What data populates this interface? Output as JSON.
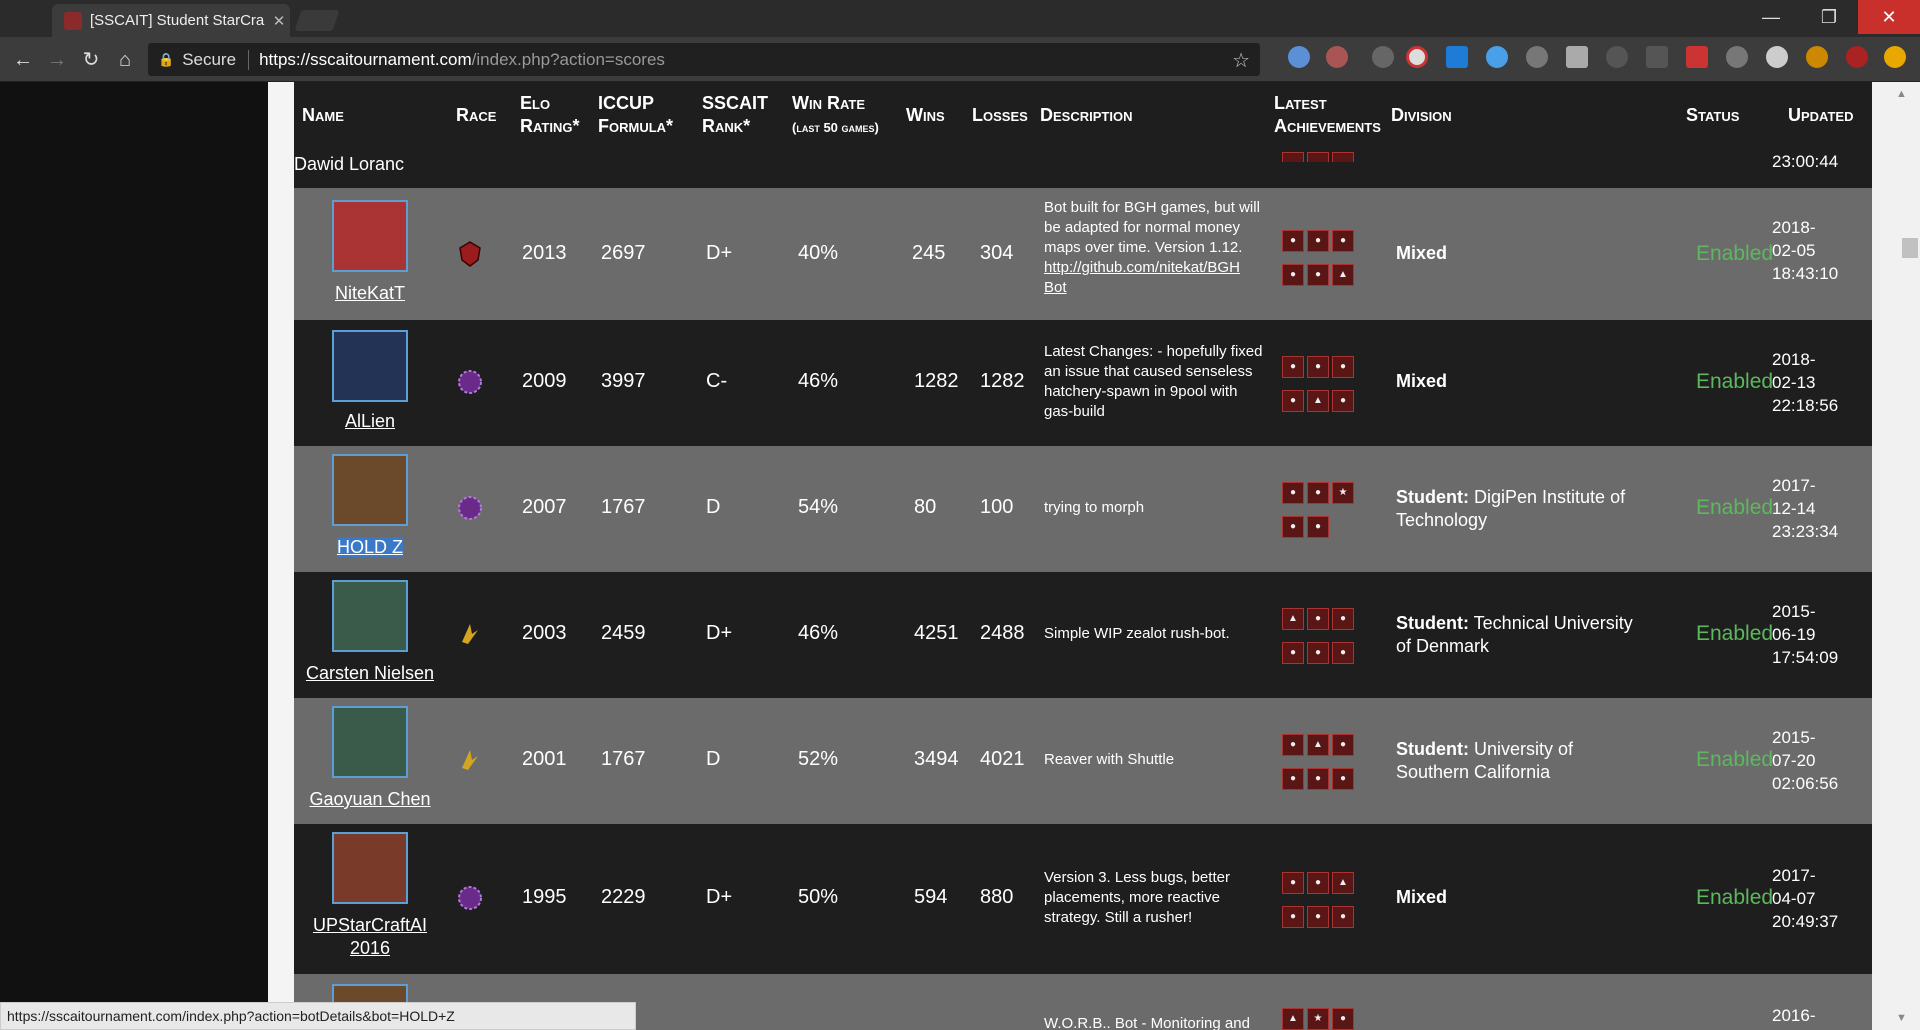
{
  "browser": {
    "tab_title": "[SSCAIT] Student StarCra",
    "url_secure": "Secure",
    "url_host": "https://sscaitournament.com",
    "url_path": "/index.php?action=scores"
  },
  "headers": {
    "name": "Name",
    "race": "Race",
    "elo1": "Elo",
    "elo2": "Rating*",
    "iccup1": "ICCUP",
    "iccup2": "Formula*",
    "rank1": "SSCAIT",
    "rank2": "Rank*",
    "winrate1": "Win Rate",
    "winrate2": "(last 50 games)",
    "wins": "Wins",
    "losses": "Losses",
    "description": "Description",
    "ach1": "Latest",
    "ach2": "Achievements",
    "division": "Division",
    "status": "Status",
    "updated": "Updated"
  },
  "partial_row": {
    "name": "Dawid Loranc",
    "updated": "23:00:44"
  },
  "rows": [
    {
      "name": "NiteKatT",
      "race": "terran",
      "elo": "2013",
      "iccup": "2697",
      "rank": "D+",
      "winrate": "40%",
      "wins": "245",
      "losses": "304",
      "desc": "Bot built for BGH games, but will be adapted for normal money maps over time. Version 1.12.",
      "desc_link": "http://github.com/nitekat/BGH Bot",
      "div_label": "Mixed",
      "div_text": "",
      "status": "Enabled",
      "upd1": "2018-",
      "upd2": "02-05",
      "upd3": "18:43:10"
    },
    {
      "name": "AlLien",
      "race": "zerg",
      "elo": "2009",
      "iccup": "3997",
      "rank": "C-",
      "winrate": "46%",
      "wins": "1282",
      "losses": "1282",
      "desc": "Latest Changes: - hopefully fixed an issue that caused senseless hatchery-spawn in 9pool with gas-build",
      "desc_link": "",
      "div_label": "Mixed",
      "div_text": "",
      "status": "Enabled",
      "upd1": "2018-",
      "upd2": "02-13",
      "upd3": "22:18:56"
    },
    {
      "name": "HOLD Z",
      "race": "zerg",
      "elo": "2007",
      "iccup": "1767",
      "rank": "D",
      "winrate": "54%",
      "wins": "80",
      "losses": "100",
      "desc": "trying to morph",
      "desc_link": "",
      "div_label": "Student:",
      "div_text": "DigiPen Institute of Technology",
      "status": "Enabled",
      "upd1": "2017-",
      "upd2": "12-14",
      "upd3": "23:23:34"
    },
    {
      "name": "Carsten Nielsen",
      "race": "protoss",
      "elo": "2003",
      "iccup": "2459",
      "rank": "D+",
      "winrate": "46%",
      "wins": "4251",
      "losses": "2488",
      "desc": "Simple WIP zealot rush-bot.",
      "desc_link": "",
      "div_label": "Student:",
      "div_text": "Technical University of Denmark",
      "status": "Enabled",
      "upd1": "2015-",
      "upd2": "06-19",
      "upd3": "17:54:09"
    },
    {
      "name": "Gaoyuan Chen",
      "race": "protoss",
      "elo": "2001",
      "iccup": "1767",
      "rank": "D",
      "winrate": "52%",
      "wins": "3494",
      "losses": "4021",
      "desc": "Reaver with Shuttle",
      "desc_link": "",
      "div_label": "Student:",
      "div_text": "University of Southern California",
      "status": "Enabled",
      "upd1": "2015-",
      "upd2": "07-20",
      "upd3": "02:06:56"
    },
    {
      "name": "UPStarCraftAI 2016",
      "race": "zerg",
      "elo": "1995",
      "iccup": "2229",
      "rank": "D+",
      "winrate": "50%",
      "wins": "594",
      "losses": "880",
      "desc": "Version 3. Less bugs, better placements, more reactive strategy. Still a rusher!",
      "desc_link": "",
      "div_label": "Mixed",
      "div_text": "",
      "status": "Enabled",
      "upd1": "2017-",
      "upd2": "04-07",
      "upd3": "20:49:37"
    }
  ],
  "bottom_row": {
    "desc": "W.O.R.B.. Bot - Monitoring and",
    "upd1": "2016-"
  },
  "status_url": "https://sscaitournament.com/index.php?action=botDetails&bot=HOLD+Z"
}
